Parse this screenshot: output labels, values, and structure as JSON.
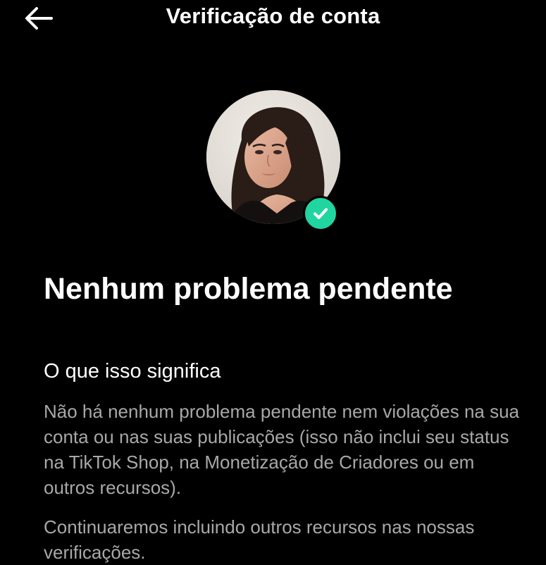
{
  "header": {
    "title": "Verificação de conta",
    "back_icon": "arrow-left-icon"
  },
  "profile": {
    "avatar": "profile-photo",
    "badge_icon": "check-circle-icon",
    "badge_color": "#20d5a0"
  },
  "status": {
    "title": "Nenhum problema pendente"
  },
  "section": {
    "heading": "O que isso significa",
    "paragraph_1": "Não há nenhum problema pendente nem violações na sua conta ou nas suas publicações (isso não inclui seu status na TikTok Shop, na Monetização de Criadores ou em outros recursos).",
    "paragraph_2": "Continuaremos incluindo outros recursos nas nossas verificações."
  },
  "colors": {
    "background": "#000000",
    "text_primary": "#ffffff",
    "text_secondary": "#a8a8a8"
  }
}
